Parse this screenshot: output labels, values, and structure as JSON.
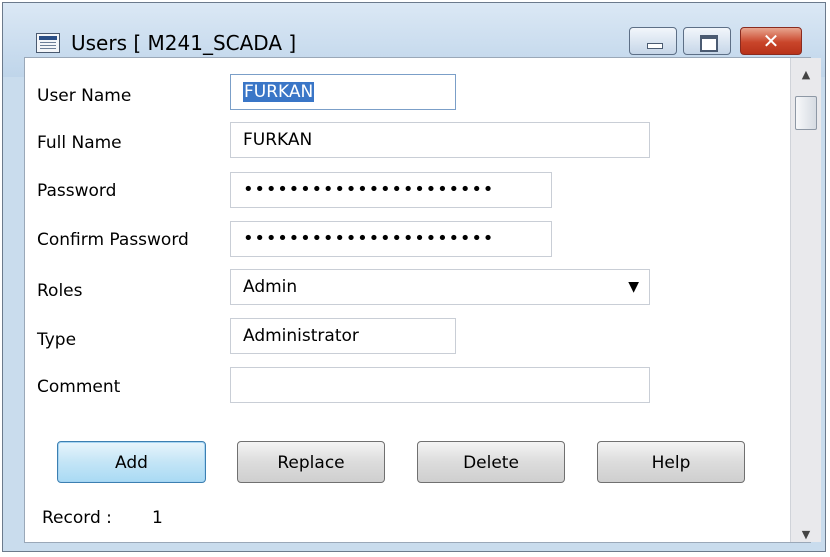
{
  "window": {
    "title": "Users [ M241_SCADA ]",
    "controls": {
      "minimize": "minimize-icon",
      "maximize": "maximize-icon",
      "close": "close-icon"
    }
  },
  "form": {
    "user_name": {
      "label": "User Name",
      "value": "FURKAN",
      "selected": true
    },
    "full_name": {
      "label": "Full Name",
      "value": "FURKAN"
    },
    "password": {
      "label": "Password",
      "value": "••••••••••••••••••••••"
    },
    "confirm_password": {
      "label": "Confirm Password",
      "value": "••••••••••••••••••••••"
    },
    "roles": {
      "label": "Roles",
      "value": "Admin"
    },
    "type": {
      "label": "Type",
      "value": "Administrator"
    },
    "comment": {
      "label": "Comment",
      "value": ""
    }
  },
  "buttons": {
    "add": "Add",
    "replace": "Replace",
    "delete": "Delete",
    "help": "Help"
  },
  "record": {
    "label": "Record :",
    "value": "1"
  },
  "colors": {
    "selection": "#3a76c7",
    "title_bar": "#c9dced",
    "close_button": "#c9452a"
  }
}
